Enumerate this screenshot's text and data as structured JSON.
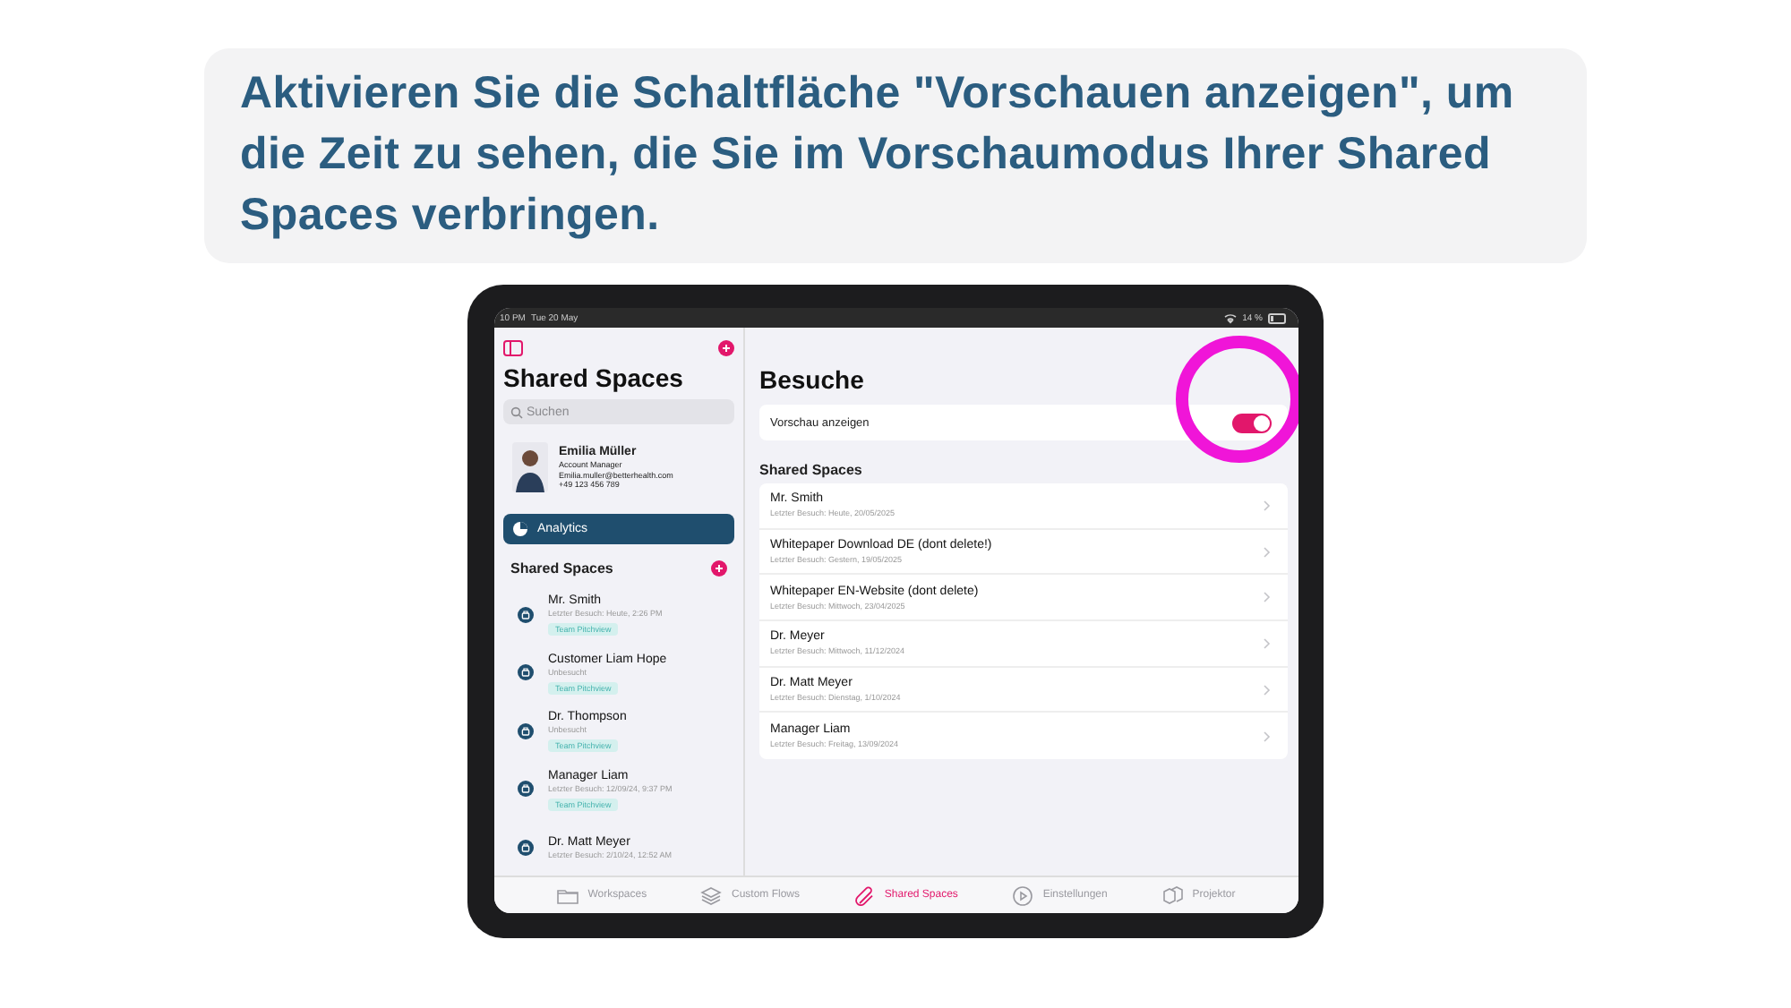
{
  "caption": {
    "text": "Aktivieren Sie die Schaltfläche \"Vorschauen anzeigen\", um die Zeit zu sehen, die Sie im Vorschaumodus Ihrer Shared Spaces verbringen."
  },
  "status_bar": {
    "time": "10 PM",
    "date": "Tue 20 May",
    "battery": "14 %"
  },
  "sidebar": {
    "title": "Shared Spaces",
    "search_placeholder": "Suchen",
    "profile": {
      "name": "Emilia Müller",
      "role": "Account Manager",
      "email": "Emilia.muller@betterhealth.com",
      "phone": "+49 123 456 789"
    },
    "analytics": {
      "label": "Analytics",
      "selected": true
    },
    "section_title": "Shared Spaces",
    "spaces": [
      {
        "name": "Mr. Smith",
        "subtitle": "Letzter Besuch: Heute, 2:26 PM",
        "tag": "Team Pitchview"
      },
      {
        "name": "Customer Liam Hope",
        "subtitle": "Unbesucht",
        "tag": "Team Pitchview"
      },
      {
        "name": "Dr. Thompson",
        "subtitle": "Unbesucht",
        "tag": "Team Pitchview"
      },
      {
        "name": "Manager Liam",
        "subtitle": "Letzter Besuch: 12/09/24, 9:37 PM",
        "tag": "Team Pitchview"
      },
      {
        "name": "Dr. Matt Meyer",
        "subtitle": "Letzter Besuch: 2/10/24, 12:52 AM"
      }
    ]
  },
  "detail": {
    "title": "Besuche",
    "preview_toggle": {
      "label": "Vorschau anzeigen",
      "on": true
    },
    "section_title": "Shared Spaces",
    "items": [
      {
        "title": "Mr. Smith",
        "subtitle": "Letzter Besuch: Heute, 20/05/2025"
      },
      {
        "title": "Whitepaper Download DE (dont delete!)",
        "subtitle": "Letzter Besuch: Gestern, 19/05/2025"
      },
      {
        "title": "Whitepaper EN-Website (dont delete)",
        "subtitle": "Letzter Besuch: Mittwoch, 23/04/2025"
      },
      {
        "title": "Dr. Meyer",
        "subtitle": "Letzter Besuch: Mittwoch, 11/12/2024"
      },
      {
        "title": "Dr. Matt Meyer",
        "subtitle": "Letzter Besuch: Dienstag, 1/10/2024"
      },
      {
        "title": "Manager Liam",
        "subtitle": "Letzter Besuch: Freitag, 13/09/2024"
      }
    ]
  },
  "tab_bar": [
    {
      "label": "Workspaces",
      "selected": false
    },
    {
      "label": "Custom Flows",
      "selected": false
    },
    {
      "label": "Shared Spaces",
      "selected": true
    },
    {
      "label": "Einstellungen",
      "selected": false
    },
    {
      "label": "Projektor",
      "selected": false
    }
  ]
}
